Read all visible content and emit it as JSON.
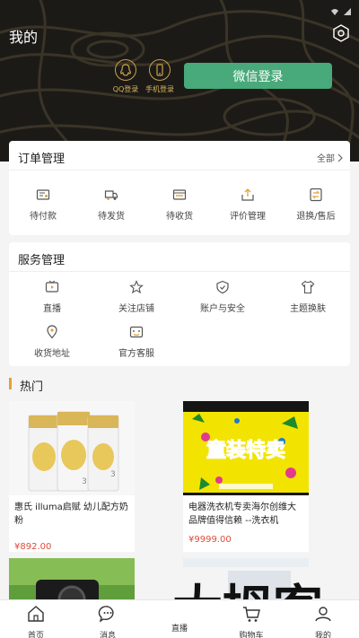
{
  "header": {
    "title": "我的",
    "qq_login": "QQ登录",
    "phone_login": "手机登录",
    "wechat_login": "微信登录"
  },
  "orders": {
    "title": "订单管理",
    "more": "全部",
    "items": [
      {
        "label": "待付款",
        "icon": "wallet-icon"
      },
      {
        "label": "待发货",
        "icon": "truck-icon"
      },
      {
        "label": "待收货",
        "icon": "inbox-icon"
      },
      {
        "label": "评价管理",
        "icon": "review-icon"
      },
      {
        "label": "退换/售后",
        "icon": "refund-icon"
      }
    ]
  },
  "services": {
    "title": "服务管理",
    "items": [
      {
        "label": "直播",
        "icon": "tv-icon"
      },
      {
        "label": "关注店铺",
        "icon": "star-icon"
      },
      {
        "label": "账户与安全",
        "icon": "shield-icon"
      },
      {
        "label": "主题换肤",
        "icon": "shirt-icon"
      },
      {
        "label": "收货地址",
        "icon": "location-icon"
      },
      {
        "label": "官方客服",
        "icon": "service-icon"
      }
    ]
  },
  "hot": {
    "title": "热门",
    "products": [
      {
        "name": "惠氏 illuma启赋 幼儿配方奶粉",
        "price": "¥892.00"
      },
      {
        "name": "电器洗衣机专卖海尔创维大品牌值得信赖 --洗衣机",
        "price": "¥9999.00",
        "banner_text": "童装特卖"
      },
      {
        "name": "",
        "price": ""
      },
      {
        "name": "",
        "price": ""
      }
    ]
  },
  "tabbar": {
    "items": [
      {
        "label": "首页",
        "icon": "home-icon"
      },
      {
        "label": "消息",
        "icon": "message-icon"
      },
      {
        "label": "直播",
        "icon": "live-icon"
      },
      {
        "label": "购物车",
        "icon": "cart-icon"
      },
      {
        "label": "我的",
        "icon": "profile-icon"
      }
    ]
  },
  "watermark": "大拇客",
  "colors": {
    "accent": "#48a97a",
    "gold": "#c9a24a",
    "price": "#e24b3b",
    "header_bg": "#1c1a17"
  }
}
